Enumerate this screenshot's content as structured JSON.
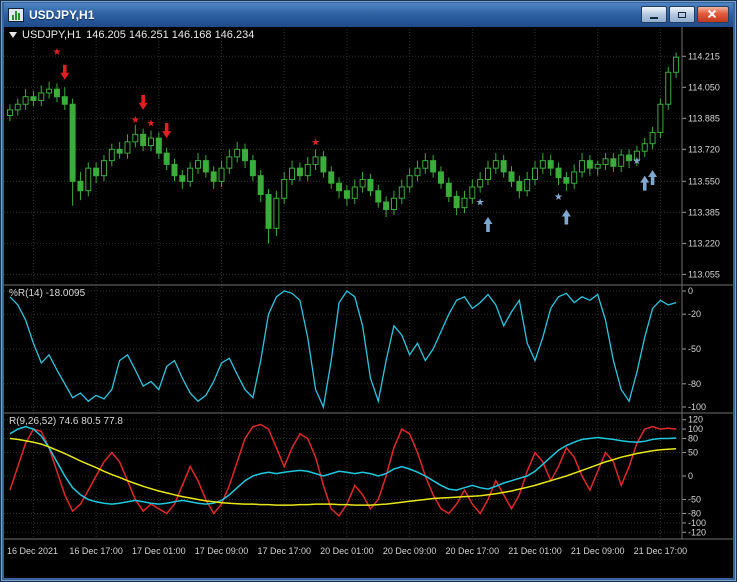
{
  "window": {
    "title": "USDJPY,H1"
  },
  "icons": {
    "titlebar": "candlestick-chart-icon",
    "dropdown": "down-triangle-icon",
    "minimize": "minimize-icon",
    "restore": "restore-down-icon",
    "close": "close-icon",
    "sell_signal": "red-down-arrow-icon",
    "buy_signal": "blue-up-arrow-icon",
    "sell_star": "red-star-icon",
    "buy_star": "blue-star-icon"
  },
  "colors": {
    "background": "#000000",
    "candle_outline": "#3aad3a",
    "bull_candle_fill": "#000000",
    "bear_candle_fill": "#3aad3a",
    "wpr_line": "#2cc5dd",
    "r3_fast": "#e02828",
    "r3_mid": "#1fc8dc",
    "r3_slow": "#e8e818",
    "sell_marker": "#e02020",
    "buy_marker": "#7fa8d0",
    "grid": "#2e2e2e",
    "axis_text": "#d4d4d4",
    "separator": "#6e6e6e"
  },
  "chart": {
    "symbol_period": "USDJPY,H1",
    "ohlc_values": "146.205 146.251 146.168 146.234",
    "wpr_label": "%R(14) -18.0095",
    "r3_label": "R(9,26,52) 74.6 80.5 77.8"
  },
  "chart_data": {
    "type": "candlestick",
    "symbol": "USDJPY",
    "timeframe": "H1",
    "price_axis_labels": [
      "114.215",
      "114.050",
      "113.885",
      "113.720",
      "113.550",
      "113.385",
      "113.220",
      "113.055"
    ],
    "time_labels": [
      "16 Dec 2021",
      "16 Dec 17:00",
      "17 Dec 01:00",
      "17 Dec 09:00",
      "17 Dec 17:00",
      "20 Dec 01:00",
      "20 Dec 09:00",
      "20 Dec 17:00",
      "21 Dec 01:00",
      "21 Dec 09:00",
      "21 Dec 17:00"
    ],
    "time_label_indices": [
      3,
      11,
      19,
      27,
      35,
      43,
      51,
      59,
      67,
      75,
      83
    ],
    "candles_ohlc": [
      [
        113.9,
        113.96,
        113.87,
        113.93
      ],
      [
        113.93,
        113.99,
        113.9,
        113.96
      ],
      [
        113.96,
        114.04,
        113.93,
        114.0
      ],
      [
        114.0,
        114.03,
        113.95,
        113.98
      ],
      [
        113.98,
        114.06,
        113.95,
        114.02
      ],
      [
        114.02,
        114.08,
        113.99,
        114.04
      ],
      [
        114.04,
        114.07,
        113.97,
        114.0
      ],
      [
        114.0,
        114.05,
        113.93,
        113.96
      ],
      [
        113.96,
        113.99,
        113.42,
        113.55
      ],
      [
        113.55,
        113.6,
        113.45,
        113.5
      ],
      [
        113.5,
        113.65,
        113.47,
        113.62
      ],
      [
        113.62,
        113.65,
        113.54,
        113.58
      ],
      [
        113.58,
        113.69,
        113.55,
        113.66
      ],
      [
        113.66,
        113.75,
        113.63,
        113.72
      ],
      [
        113.72,
        113.76,
        113.67,
        113.7
      ],
      [
        113.7,
        113.8,
        113.67,
        113.76
      ],
      [
        113.76,
        113.85,
        113.73,
        113.8
      ],
      [
        113.8,
        113.83,
        113.71,
        113.74
      ],
      [
        113.74,
        113.82,
        113.71,
        113.78
      ],
      [
        113.78,
        113.81,
        113.67,
        113.7
      ],
      [
        113.7,
        113.73,
        113.61,
        113.64
      ],
      [
        113.64,
        113.67,
        113.55,
        113.58
      ],
      [
        113.58,
        113.61,
        113.51,
        113.55
      ],
      [
        113.55,
        113.65,
        113.52,
        113.62
      ],
      [
        113.62,
        113.7,
        113.59,
        113.66
      ],
      [
        113.66,
        113.69,
        113.57,
        113.6
      ],
      [
        113.6,
        113.63,
        113.51,
        113.55
      ],
      [
        113.55,
        113.66,
        113.52,
        113.62
      ],
      [
        113.62,
        113.72,
        113.59,
        113.68
      ],
      [
        113.68,
        113.76,
        113.65,
        113.72
      ],
      [
        113.72,
        113.75,
        113.62,
        113.66
      ],
      [
        113.66,
        113.69,
        113.55,
        113.58
      ],
      [
        113.58,
        113.61,
        113.44,
        113.48
      ],
      [
        113.48,
        113.51,
        113.22,
        113.3
      ],
      [
        113.3,
        113.5,
        113.26,
        113.46
      ],
      [
        113.46,
        113.6,
        113.43,
        113.56
      ],
      [
        113.56,
        113.66,
        113.53,
        113.62
      ],
      [
        113.62,
        113.65,
        113.55,
        113.58
      ],
      [
        113.58,
        113.68,
        113.55,
        113.64
      ],
      [
        113.64,
        113.72,
        113.61,
        113.68
      ],
      [
        113.68,
        113.71,
        113.57,
        113.6
      ],
      [
        113.6,
        113.63,
        113.51,
        113.54
      ],
      [
        113.54,
        113.57,
        113.46,
        113.5
      ],
      [
        113.5,
        113.53,
        113.42,
        113.46
      ],
      [
        113.46,
        113.56,
        113.43,
        113.52
      ],
      [
        113.52,
        113.6,
        113.49,
        113.56
      ],
      [
        113.56,
        113.59,
        113.47,
        113.5
      ],
      [
        113.5,
        113.53,
        113.41,
        113.44
      ],
      [
        113.44,
        113.47,
        113.36,
        113.4
      ],
      [
        113.4,
        113.5,
        113.37,
        113.46
      ],
      [
        113.46,
        113.56,
        113.43,
        113.52
      ],
      [
        113.52,
        113.62,
        113.49,
        113.58
      ],
      [
        113.58,
        113.66,
        113.55,
        113.62
      ],
      [
        113.62,
        113.7,
        113.59,
        113.66
      ],
      [
        113.66,
        113.69,
        113.57,
        113.6
      ],
      [
        113.6,
        113.63,
        113.51,
        113.54
      ],
      [
        113.54,
        113.57,
        113.44,
        113.47
      ],
      [
        113.47,
        113.5,
        113.37,
        113.41
      ],
      [
        113.41,
        113.5,
        113.38,
        113.46
      ],
      [
        113.46,
        113.56,
        113.43,
        113.52
      ],
      [
        113.52,
        113.6,
        113.49,
        113.56
      ],
      [
        113.56,
        113.66,
        113.53,
        113.62
      ],
      [
        113.62,
        113.7,
        113.59,
        113.66
      ],
      [
        113.66,
        113.69,
        113.57,
        113.6
      ],
      [
        113.6,
        113.63,
        113.52,
        113.55
      ],
      [
        113.55,
        113.58,
        113.46,
        113.5
      ],
      [
        113.5,
        113.6,
        113.47,
        113.56
      ],
      [
        113.56,
        113.66,
        113.53,
        113.62
      ],
      [
        113.62,
        113.7,
        113.59,
        113.66
      ],
      [
        113.66,
        113.69,
        113.58,
        113.62
      ],
      [
        113.62,
        113.65,
        113.53,
        113.57
      ],
      [
        113.57,
        113.6,
        113.5,
        113.54
      ],
      [
        113.54,
        113.64,
        113.51,
        113.6
      ],
      [
        113.6,
        113.7,
        113.57,
        113.66
      ],
      [
        113.66,
        113.69,
        113.58,
        113.62
      ],
      [
        113.62,
        113.66,
        113.58,
        113.64
      ],
      [
        113.64,
        113.7,
        113.61,
        113.67
      ],
      [
        113.67,
        113.7,
        113.6,
        113.63
      ],
      [
        113.63,
        113.72,
        113.6,
        113.69
      ],
      [
        113.69,
        113.72,
        113.62,
        113.66
      ],
      [
        113.66,
        113.74,
        113.63,
        113.71
      ],
      [
        113.71,
        113.78,
        113.68,
        113.75
      ],
      [
        113.75,
        113.84,
        113.72,
        113.81
      ],
      [
        113.81,
        113.99,
        113.78,
        113.96
      ],
      [
        113.96,
        114.16,
        113.93,
        114.13
      ],
      [
        114.13,
        114.235,
        114.1,
        114.21
      ]
    ],
    "markers": [
      {
        "index": 6,
        "price": 114.24,
        "type": "sell-star"
      },
      {
        "index": 7,
        "price": 114.09,
        "type": "sell-arrow"
      },
      {
        "index": 16,
        "price": 113.88,
        "type": "sell-star"
      },
      {
        "index": 17,
        "price": 113.93,
        "type": "sell-arrow"
      },
      {
        "index": 18,
        "price": 113.86,
        "type": "sell-star"
      },
      {
        "index": 20,
        "price": 113.78,
        "type": "sell-arrow"
      },
      {
        "index": 39,
        "price": 113.76,
        "type": "sell-star"
      },
      {
        "index": 60,
        "price": 113.44,
        "type": "buy-star"
      },
      {
        "index": 61,
        "price": 113.36,
        "type": "buy-arrow"
      },
      {
        "index": 70,
        "price": 113.47,
        "type": "buy-star"
      },
      {
        "index": 71,
        "price": 113.4,
        "type": "buy-arrow"
      },
      {
        "index": 80,
        "price": 113.66,
        "type": "buy-star"
      },
      {
        "index": 81,
        "price": 113.58,
        "type": "buy-arrow"
      },
      {
        "index": 82,
        "price": 113.61,
        "type": "buy-arrow"
      }
    ],
    "panels": [
      {
        "name": "williams_percent_r",
        "label": "%R(14) -18.0095",
        "axis_labels": [
          "0",
          "-20",
          "-50",
          "-80",
          "-100"
        ],
        "range": [
          -100,
          0
        ],
        "series": [
          {
            "name": "%R",
            "color": "#2cc5dd",
            "values": [
              -5,
              -12,
              -25,
              -45,
              -62,
              -55,
              -68,
              -80,
              -92,
              -88,
              -95,
              -90,
              -93,
              -85,
              -60,
              -55,
              -68,
              -82,
              -78,
              -85,
              -65,
              -60,
              -75,
              -88,
              -95,
              -90,
              -78,
              -62,
              -58,
              -72,
              -85,
              -92,
              -60,
              -20,
              -5,
              0,
              -2,
              -8,
              -40,
              -85,
              -100,
              -60,
              -10,
              0,
              -5,
              -30,
              -75,
              -95,
              -60,
              -30,
              -38,
              -55,
              -45,
              -60,
              -50,
              -35,
              -20,
              -8,
              -5,
              -15,
              -10,
              -3,
              -12,
              -30,
              -18,
              -8,
              -45,
              -60,
              -40,
              -15,
              -5,
              -2,
              -10,
              -5,
              -8,
              -3,
              -25,
              -60,
              -85,
              -95,
              -70,
              -40,
              -15,
              -8,
              -12,
              -10
            ]
          }
        ]
      },
      {
        "name": "triple_oscillator",
        "label": "R(9,26,52) 74.6 80.5 77.8",
        "axis_labels": [
          "120",
          "100",
          "80",
          "50",
          "0",
          "-50",
          "-80",
          "-100",
          "-120"
        ],
        "range": [
          -130,
          130
        ],
        "series": [
          {
            "name": "fast",
            "color": "#e02828",
            "values": [
              -30,
              20,
              70,
              100,
              95,
              60,
              10,
              -40,
              -75,
              -60,
              -30,
              0,
              30,
              50,
              30,
              -10,
              -50,
              -75,
              -60,
              -70,
              -80,
              -60,
              -20,
              20,
              -10,
              -50,
              -80,
              -60,
              -20,
              30,
              80,
              105,
              110,
              100,
              60,
              20,
              60,
              90,
              80,
              40,
              -20,
              -70,
              -85,
              -60,
              -20,
              -40,
              -70,
              -50,
              0,
              60,
              100,
              90,
              50,
              0,
              -40,
              -70,
              -80,
              -60,
              -30,
              -60,
              -80,
              -50,
              -10,
              -40,
              -70,
              -40,
              10,
              50,
              30,
              -10,
              20,
              60,
              40,
              0,
              -30,
              10,
              50,
              30,
              -20,
              20,
              70,
              100,
              105,
              100,
              102,
              100
            ]
          },
          {
            "name": "mid",
            "color": "#1fc8dc",
            "values": [
              90,
              100,
              105,
              100,
              85,
              60,
              30,
              0,
              -25,
              -40,
              -50,
              -55,
              -58,
              -60,
              -58,
              -55,
              -52,
              -55,
              -58,
              -60,
              -58,
              -55,
              -52,
              -55,
              -58,
              -60,
              -58,
              -52,
              -40,
              -25,
              -10,
              0,
              5,
              8,
              5,
              8,
              10,
              12,
              10,
              5,
              0,
              5,
              10,
              8,
              5,
              8,
              5,
              0,
              5,
              15,
              20,
              15,
              8,
              0,
              -10,
              -20,
              -28,
              -30,
              -25,
              -20,
              -25,
              -28,
              -22,
              -15,
              -10,
              -5,
              0,
              10,
              25,
              40,
              55,
              65,
              72,
              78,
              80,
              82,
              80,
              78,
              75,
              73,
              72,
              74,
              78,
              80,
              80,
              81
            ]
          },
          {
            "name": "slow",
            "color": "#e8e818",
            "values": [
              80,
              78,
              75,
              72,
              68,
              62,
              55,
              48,
              40,
              32,
              25,
              18,
              10,
              3,
              -3,
              -10,
              -16,
              -22,
              -27,
              -32,
              -36,
              -40,
              -44,
              -47,
              -50,
              -53,
              -55,
              -57,
              -58,
              -59,
              -60,
              -60,
              -61,
              -61,
              -62,
              -62,
              -62,
              -61,
              -61,
              -60,
              -60,
              -60,
              -61,
              -61,
              -62,
              -62,
              -62,
              -61,
              -60,
              -58,
              -56,
              -54,
              -52,
              -50,
              -48,
              -47,
              -46,
              -45,
              -44,
              -43,
              -42,
              -40,
              -38,
              -35,
              -32,
              -28,
              -24,
              -20,
              -15,
              -10,
              -5,
              0,
              6,
              12,
              18,
              24,
              30,
              35,
              40,
              44,
              48,
              51,
              54,
              56,
              57,
              58
            ]
          }
        ]
      }
    ]
  }
}
